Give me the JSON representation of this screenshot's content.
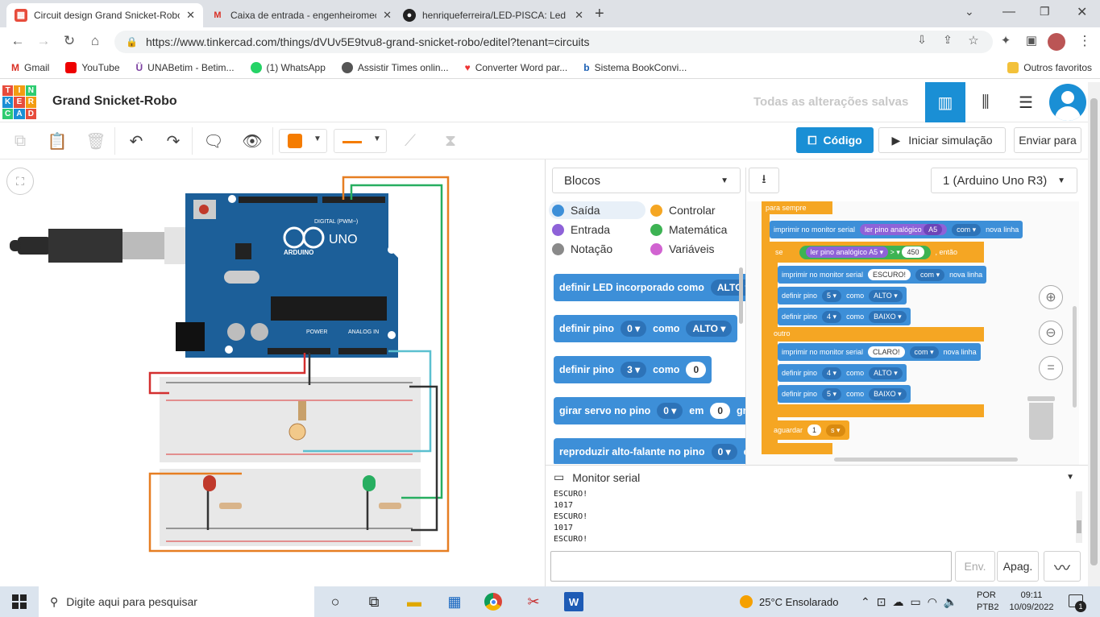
{
  "browser": {
    "tabs": [
      {
        "title": "Circuit design Grand Snicket-Robo",
        "active": true
      },
      {
        "title": "Caixa de entrada - engenheiromec",
        "active": false
      },
      {
        "title": "henriqueferreira/LED-PISCA: Led",
        "active": false
      }
    ],
    "url": "https://www.tinkercad.com/things/dVUv5E9tvu8-grand-snicket-robo/editel?tenant=circuits",
    "bookmarks": [
      "Gmail",
      "YouTube",
      "UNABetim - Betim...",
      "(1) WhatsApp",
      "Assistir Times onlin...",
      "Converter Word par...",
      "Sistema BookConvi..."
    ],
    "other_bookmarks": "Outros favoritos"
  },
  "app": {
    "logo_letters": [
      "T",
      "I",
      "N",
      "K",
      "E",
      "R",
      "C",
      "A",
      "D"
    ],
    "title": "Grand Snicket-Robo",
    "saved_status": "Todas as alterações salvas",
    "code_button": "Código",
    "simulate_button": "Iniciar simulação",
    "send_button": "Enviar para",
    "accent_color": "#1a8fd5"
  },
  "code_panel": {
    "mode_dropdown": "Blocos",
    "device_dropdown": "1 (Arduino Uno R3)",
    "categories": [
      {
        "label": "Saída",
        "color": "#3d8fd8"
      },
      {
        "label": "Controlar",
        "color": "#f5a623"
      },
      {
        "label": "Entrada",
        "color": "#8e62d8"
      },
      {
        "label": "Matemática",
        "color": "#3db353"
      },
      {
        "label": "Notação",
        "color": "#8a8a8a"
      },
      {
        "label": "Variáveis",
        "color": "#d163d1"
      }
    ],
    "palette_blocks": {
      "b1_text": "definir LED incorporado como",
      "b1_value": "ALTO",
      "b2_text": "definir pino",
      "b2_pin": "0",
      "b2_como": "como",
      "b2_value": "ALTO",
      "b3_text": "definir pino",
      "b3_pin": "3",
      "b3_como": "como",
      "b3_value": "0",
      "b4_text": "girar servo no pino",
      "b4_pin": "0",
      "b4_em": "em",
      "b4_value": "0",
      "b4_unit": "graus",
      "b5_text": "reproduzir alto-falante no pino",
      "b5_pin": "0",
      "b5_com": "com"
    },
    "script": {
      "forever": "para sempre",
      "print1": "imprimir no monitor serial",
      "read1": "ler pino analógico",
      "pinA5": "A5",
      "com": "com",
      "newline": "nova linha",
      "if": "se",
      "read2": "ler pino analógico",
      "op": ">",
      "threshold": "450",
      "then": ", então",
      "print2": "imprimir no monitor serial",
      "escuro": "ESCURO!",
      "set": "definir pino",
      "como": "como",
      "pin5": "5",
      "pin4": "4",
      "alto": "ALTO",
      "baixo": "BAIXO",
      "else": "outro",
      "claro": "CLARO!",
      "wait": "aguardar",
      "wait_value": "1",
      "wait_unit": "s"
    },
    "serial_title": "Monitor serial",
    "serial_lines": [
      "ESCURO!",
      "1017",
      "ESCURO!",
      "1017",
      "ESCURO!"
    ],
    "send": "Env.",
    "clear": "Apag."
  },
  "taskbar": {
    "search_placeholder": "Digite aqui para pesquisar",
    "weather": "25°C  Ensolarado",
    "lang1": "POR",
    "lang2": "PTB2",
    "time": "09:11",
    "date": "10/09/2022",
    "notifications": "1"
  },
  "board": {
    "brand": "ARDUINO",
    "model": "UNO",
    "digital": "DIGITAL (PWM~)",
    "power": "POWER",
    "analog": "ANALOG IN"
  }
}
